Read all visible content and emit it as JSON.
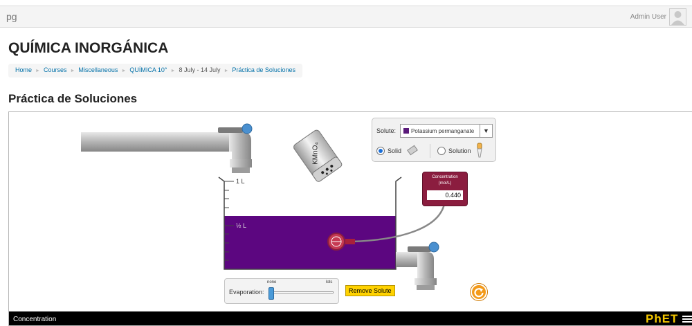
{
  "navbar": {
    "brand": "pg",
    "user_name": "Admin User"
  },
  "page_title": "QUÍMICA INORGÁNICA",
  "breadcrumb": [
    "Home",
    "Courses",
    "Miscellaneous",
    "QUÍMICA 10°",
    "8 July - 14 July",
    "Práctica de Soluciones"
  ],
  "section_title": "Práctica de Soluciones",
  "simulation": {
    "shaker_label": "KMnO₄",
    "solute_label": "Solute:",
    "solute_value": "Potassium permanganate",
    "solute_color": "#5a1a7a",
    "solid_label": "Solid",
    "solution_label": "Solution",
    "solid_selected": true,
    "beaker_label_1l": "1 L",
    "beaker_label_half": "½ L",
    "solution_color": "#5c0680",
    "concentration_title": "Concentration",
    "concentration_units": "(mol/L)",
    "concentration_value": "0.440",
    "evaporation_label": "Evaporation:",
    "evaporation_min": "none",
    "evaporation_max": "lots",
    "evaporation_level": 0,
    "remove_solute_label": "Remove Solute",
    "sim_name": "Concentration",
    "phet_logo": "PhET",
    "icons": [
      "avatar-icon",
      "shaker-icon",
      "dropper-icon",
      "faucet-icon",
      "probe-icon",
      "reset-icon",
      "menu-icon"
    ]
  }
}
